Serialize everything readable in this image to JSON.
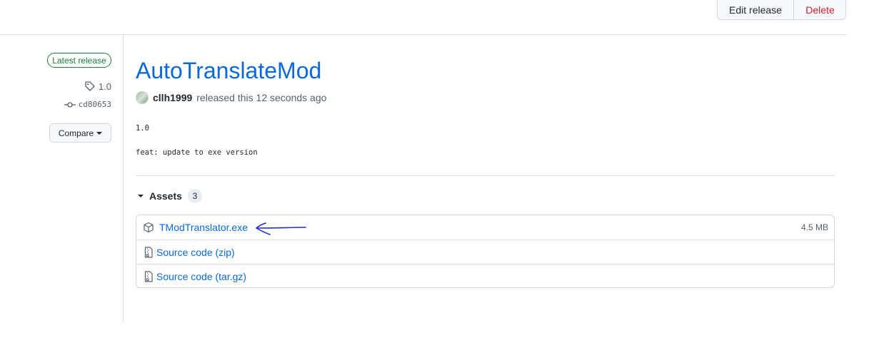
{
  "toolbar": {
    "edit_label": "Edit release",
    "delete_label": "Delete"
  },
  "sidebar": {
    "badge": "Latest release",
    "tag": "1.0",
    "commit": "cd80653",
    "compare_label": "Compare"
  },
  "release": {
    "title": "AutoTranslateMod",
    "author": "cllh1999",
    "released_text": "released this 12 seconds ago",
    "body_lines": [
      "1.0",
      "feat: update to exe version"
    ]
  },
  "assets": {
    "label": "Assets",
    "count": "3",
    "items": [
      {
        "name": "TModTranslator.exe",
        "size": "4.5 MB",
        "icon": "package-icon"
      },
      {
        "name": "Source code",
        "suffix": "(zip)",
        "icon": "file-zip-icon"
      },
      {
        "name": "Source code",
        "suffix": "(tar.gz)",
        "icon": "file-zip-icon"
      }
    ]
  },
  "colors": {
    "link": "#0969da",
    "badge": "#1a7f37",
    "delete": "#cf222e",
    "annotation_arrow": "#1f2bd6"
  }
}
